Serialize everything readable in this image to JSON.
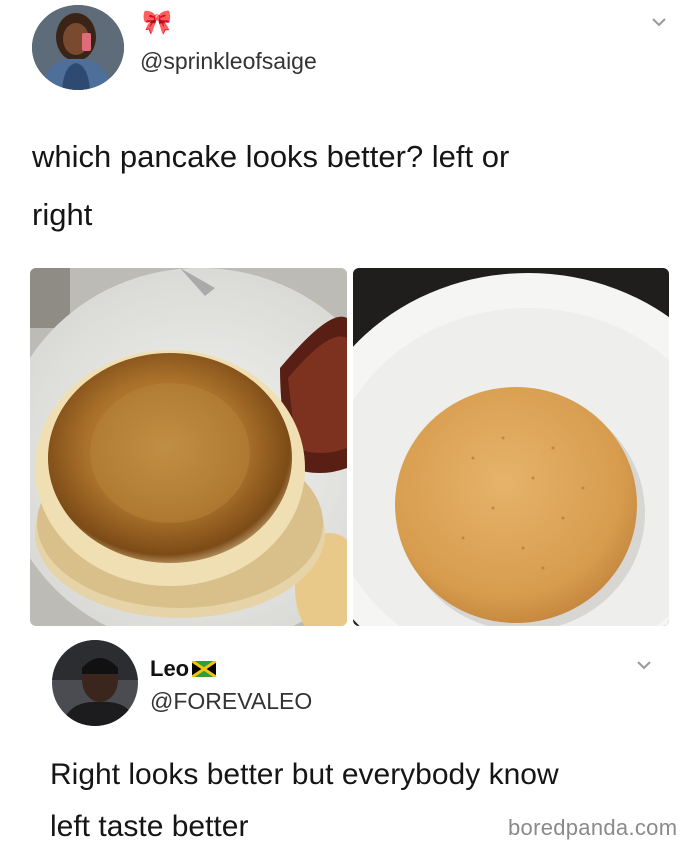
{
  "tweet": {
    "author_emoji": "🎀",
    "handle": "@sprinkleofsaige",
    "text_line1": "which pancake looks better? left or",
    "text_line2": "right",
    "avatar_icon": "profile-photo-woman",
    "menu_icon": "chevron-down-icon"
  },
  "images": {
    "left": "pancake-golden-brown-fluffy",
    "right": "pancake-flat-smooth-even"
  },
  "reply": {
    "name": "Leo",
    "flag_icon": "jamaica-flag-icon",
    "handle": "@FOREVALEO",
    "text_line1": "Right looks better but everybody know",
    "text_line2": "left taste better",
    "avatar_icon": "profile-photo-man",
    "menu_icon": "chevron-down-icon"
  },
  "watermark": "boredpanda.com",
  "colors": {
    "background": "#ffffff",
    "text": "#151515",
    "muted": "#8a8a8a"
  }
}
